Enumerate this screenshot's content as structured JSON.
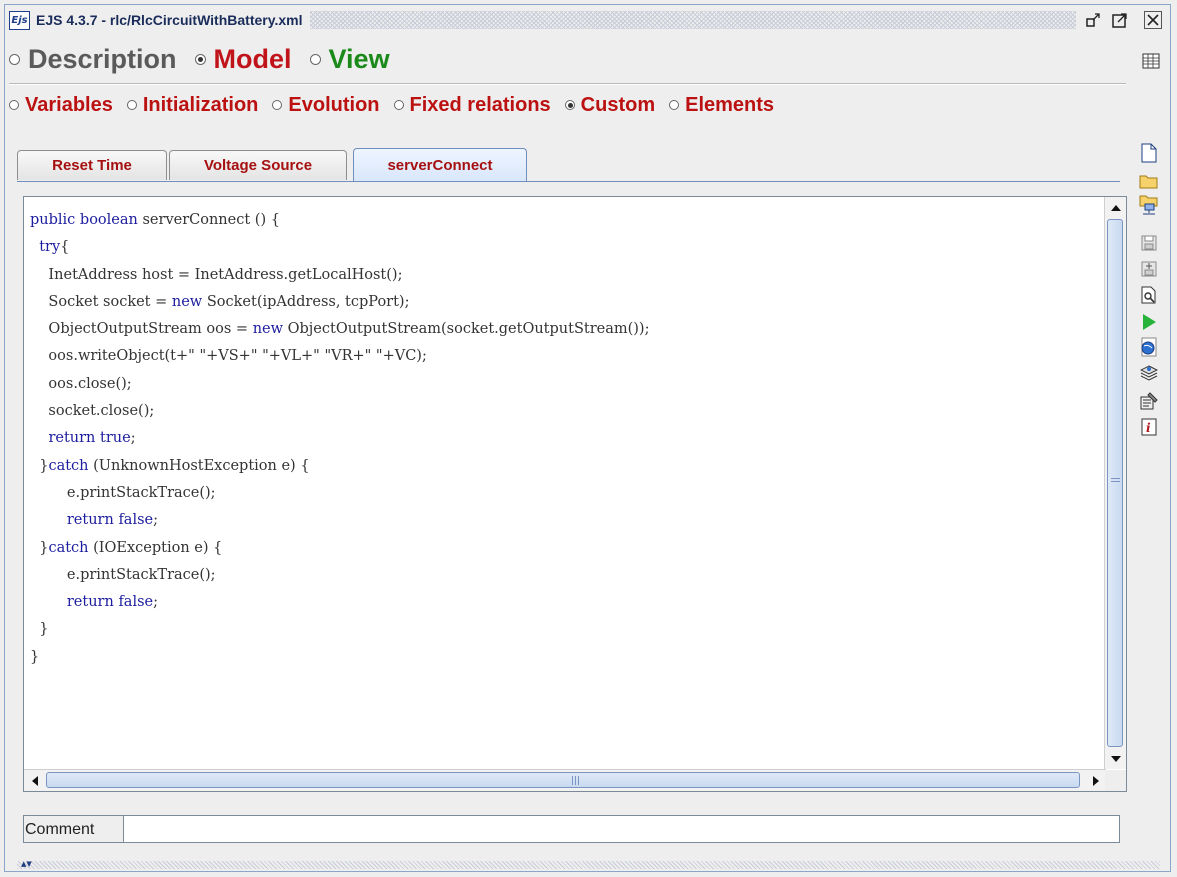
{
  "window": {
    "title": "EJS 4.3.7 - rlc/RlcCircuitWithBattery.xml",
    "app_icon_text": "Ejs",
    "restore_glyph": "↙",
    "maximize_glyph": "↗",
    "close_glyph": "✕"
  },
  "main_tabs": [
    {
      "label": "Description",
      "selected": false,
      "color": "#5a5a5a"
    },
    {
      "label": "Model",
      "selected": true,
      "color": "#c0141a"
    },
    {
      "label": "View",
      "selected": false,
      "color": "#1b8a1b"
    }
  ],
  "model_sections": [
    {
      "label": "Variables",
      "selected": false
    },
    {
      "label": "Initialization",
      "selected": false
    },
    {
      "label": "Evolution",
      "selected": false
    },
    {
      "label": "Fixed relations",
      "selected": false
    },
    {
      "label": "Custom",
      "selected": true
    },
    {
      "label": "Elements",
      "selected": false
    }
  ],
  "custom_tabs": [
    {
      "label": "Reset Time",
      "active": false
    },
    {
      "label": "Voltage Source",
      "active": false
    },
    {
      "label": "serverConnect",
      "active": true
    }
  ],
  "code_lines": [
    "public boolean serverConnect () {",
    "  try{",
    "    InetAddress host = InetAddress.getLocalHost();",
    "    Socket socket = new Socket(ipAddress, tcpPort);",
    "    ObjectOutputStream oos = new ObjectOutputStream(socket.getOutputStream());",
    "    oos.writeObject(t+\" \"+VS+\" \"+VL+\" \"VR+\" \"+VC);",
    "    oos.close();",
    "    socket.close();",
    "    return true;",
    "  }catch (UnknownHostException e) {",
    "        e.printStackTrace();",
    "        return false;",
    "  }catch (IOException e) {",
    "        e.printStackTrace();",
    "        return false;",
    "  }",
    "}"
  ],
  "keywords": [
    "public",
    "boolean",
    "try",
    "new",
    "return",
    "true",
    "false",
    "catch"
  ],
  "comment": {
    "label": "Comment",
    "value": ""
  },
  "toolbar_icons": [
    "new-file-icon",
    "open-folder-icon",
    "open-network-icon",
    "save-icon",
    "save-as-icon",
    "search-icon",
    "run-icon",
    "web-icon",
    "stack-icon",
    "options-icon",
    "info-icon"
  ],
  "table_icon": "table-icon",
  "colors": {
    "accent_blue": "#6e8fc0",
    "section_red": "#bb1111",
    "keyword": "#1c1c9f"
  }
}
